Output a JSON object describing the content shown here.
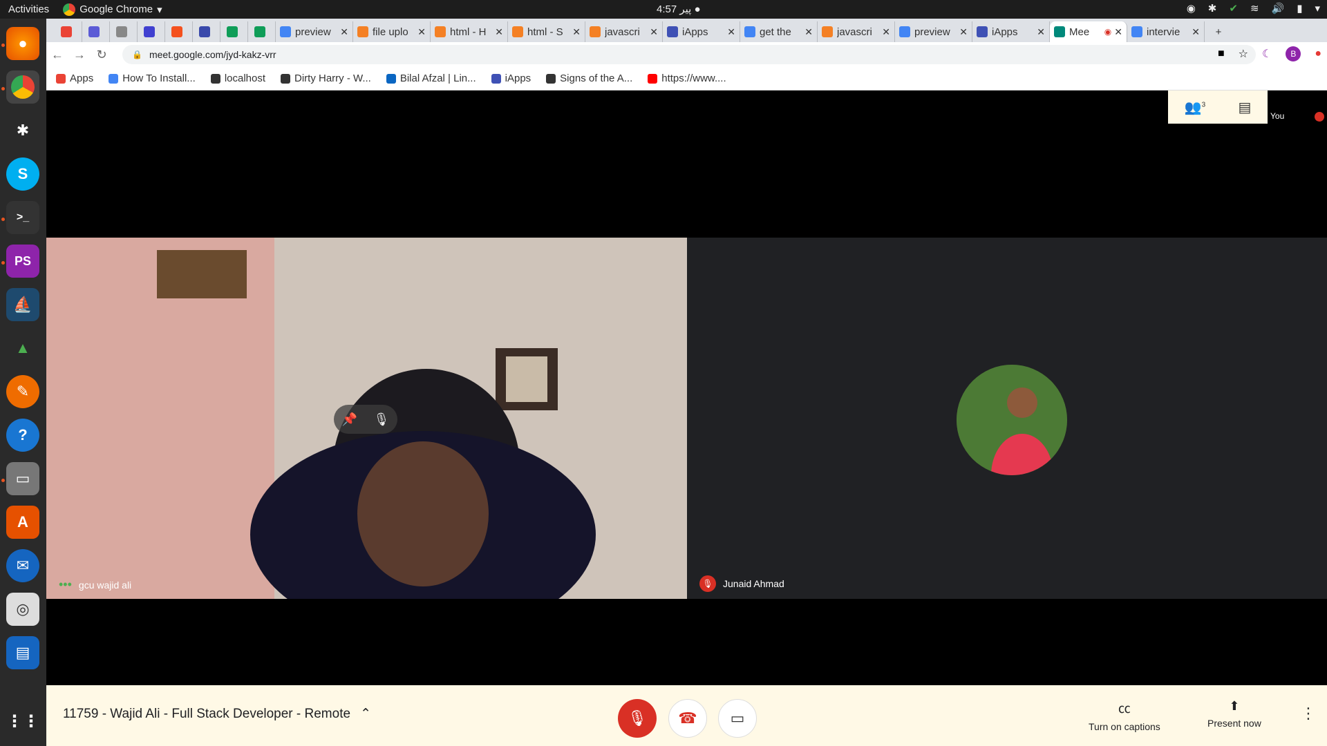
{
  "system": {
    "activities": "Activities",
    "app_name": "Google Chrome",
    "clock": "4:57 پیر ●"
  },
  "tabs": [
    {
      "label": "",
      "color": "#ea4335"
    },
    {
      "label": "",
      "color": "#5b5bd6"
    },
    {
      "label": "",
      "color": "#888888"
    },
    {
      "label": "",
      "color": "#4040d0"
    },
    {
      "label": "",
      "color": "#f4511e"
    },
    {
      "label": "",
      "color": "#3949ab"
    },
    {
      "label": "",
      "color": "#0f9d58"
    },
    {
      "label": "",
      "color": "#0f9d58"
    },
    {
      "label": "preview",
      "color": "#4285f4"
    },
    {
      "label": "file uplo",
      "color": "#f48024"
    },
    {
      "label": "html - H",
      "color": "#f48024"
    },
    {
      "label": "html - S",
      "color": "#f48024"
    },
    {
      "label": "javascri",
      "color": "#f48024"
    },
    {
      "label": "iApps",
      "color": "#3f51b5"
    },
    {
      "label": "get the",
      "color": "#4285f4"
    },
    {
      "label": "javascri",
      "color": "#f48024"
    },
    {
      "label": "preview",
      "color": "#4285f4"
    },
    {
      "label": "iApps",
      "color": "#3f51b5"
    },
    {
      "label": "Mee",
      "color": "#00897b"
    },
    {
      "label": "intervie",
      "color": "#4285f4"
    }
  ],
  "address_bar": {
    "url": "meet.google.com/jyd-kakz-vrr",
    "profile_initial": "B"
  },
  "bookmarks": [
    {
      "label": "Apps",
      "color": "#ea4335"
    },
    {
      "label": "How To Install...",
      "color": "#4285f4"
    },
    {
      "label": "localhost",
      "color": "#333333"
    },
    {
      "label": "Dirty Harry - W...",
      "color": "#333333"
    },
    {
      "label": "Bilal Afzal | Lin...",
      "color": "#0a66c2"
    },
    {
      "label": "iApps",
      "color": "#3f51b5"
    },
    {
      "label": "Signs of the A...",
      "color": "#333333"
    },
    {
      "label": "https://www....",
      "color": "#ff0000"
    }
  ],
  "meet": {
    "participants_count": "3",
    "self_label": "You",
    "participants": [
      {
        "name": "gcu wajid ali"
      },
      {
        "name": "Junaid Ahmad"
      }
    ],
    "meeting_title": "11759 - Wajid Ali - Full Stack Developer - Remote",
    "captions_label": "Turn on captions",
    "present_label": "Present now"
  },
  "colors": {
    "accent_red": "#d93025",
    "bar_bg": "#fff9e6"
  }
}
